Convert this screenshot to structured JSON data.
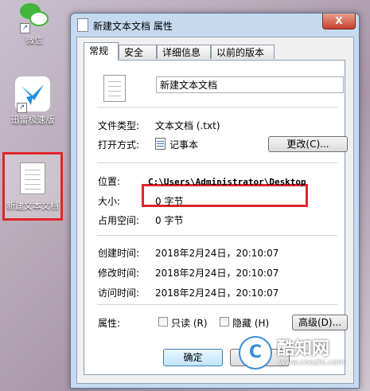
{
  "desktop": {
    "icons": [
      {
        "label": "微信"
      },
      {
        "label": "迅雷极速版"
      },
      {
        "label": "新建文本文档"
      }
    ]
  },
  "window": {
    "title": "新建文本文档 属性",
    "close_label": "X"
  },
  "tabs": [
    {
      "label": "常规"
    },
    {
      "label": "安全"
    },
    {
      "label": "详细信息"
    },
    {
      "label": "以前的版本"
    }
  ],
  "general": {
    "file_name": "新建文本文档",
    "type_label": "文件类型:",
    "type_value": "文本文档 (.txt)",
    "open_with_label": "打开方式:",
    "open_with_value": "记事本",
    "change_button": "更改(C)...",
    "location_label": "位置:",
    "location_value": "C:\\Users\\Administrator\\Desktop",
    "size_label": "大小:",
    "size_value": "0 字节",
    "disk_size_label": "占用空间:",
    "disk_size_value": "0 字节",
    "created_label": "创建时间:",
    "created_value": "2018年2月24日，20:10:07",
    "modified_label": "修改时间:",
    "modified_value": "2018年2月24日，20:10:07",
    "accessed_label": "访问时间:",
    "accessed_value": "2018年2月24日，20:10:07",
    "attributes_label": "属性:",
    "readonly_label": "只读 (R)",
    "hidden_label": "隐藏 (H)",
    "advanced_button": "高级(D)..."
  },
  "footer": {
    "ok_label": "确定",
    "cancel_label": "取消"
  },
  "watermark": {
    "logo": "C",
    "brand": "酷知网",
    "url": "www.coozhi.com"
  }
}
